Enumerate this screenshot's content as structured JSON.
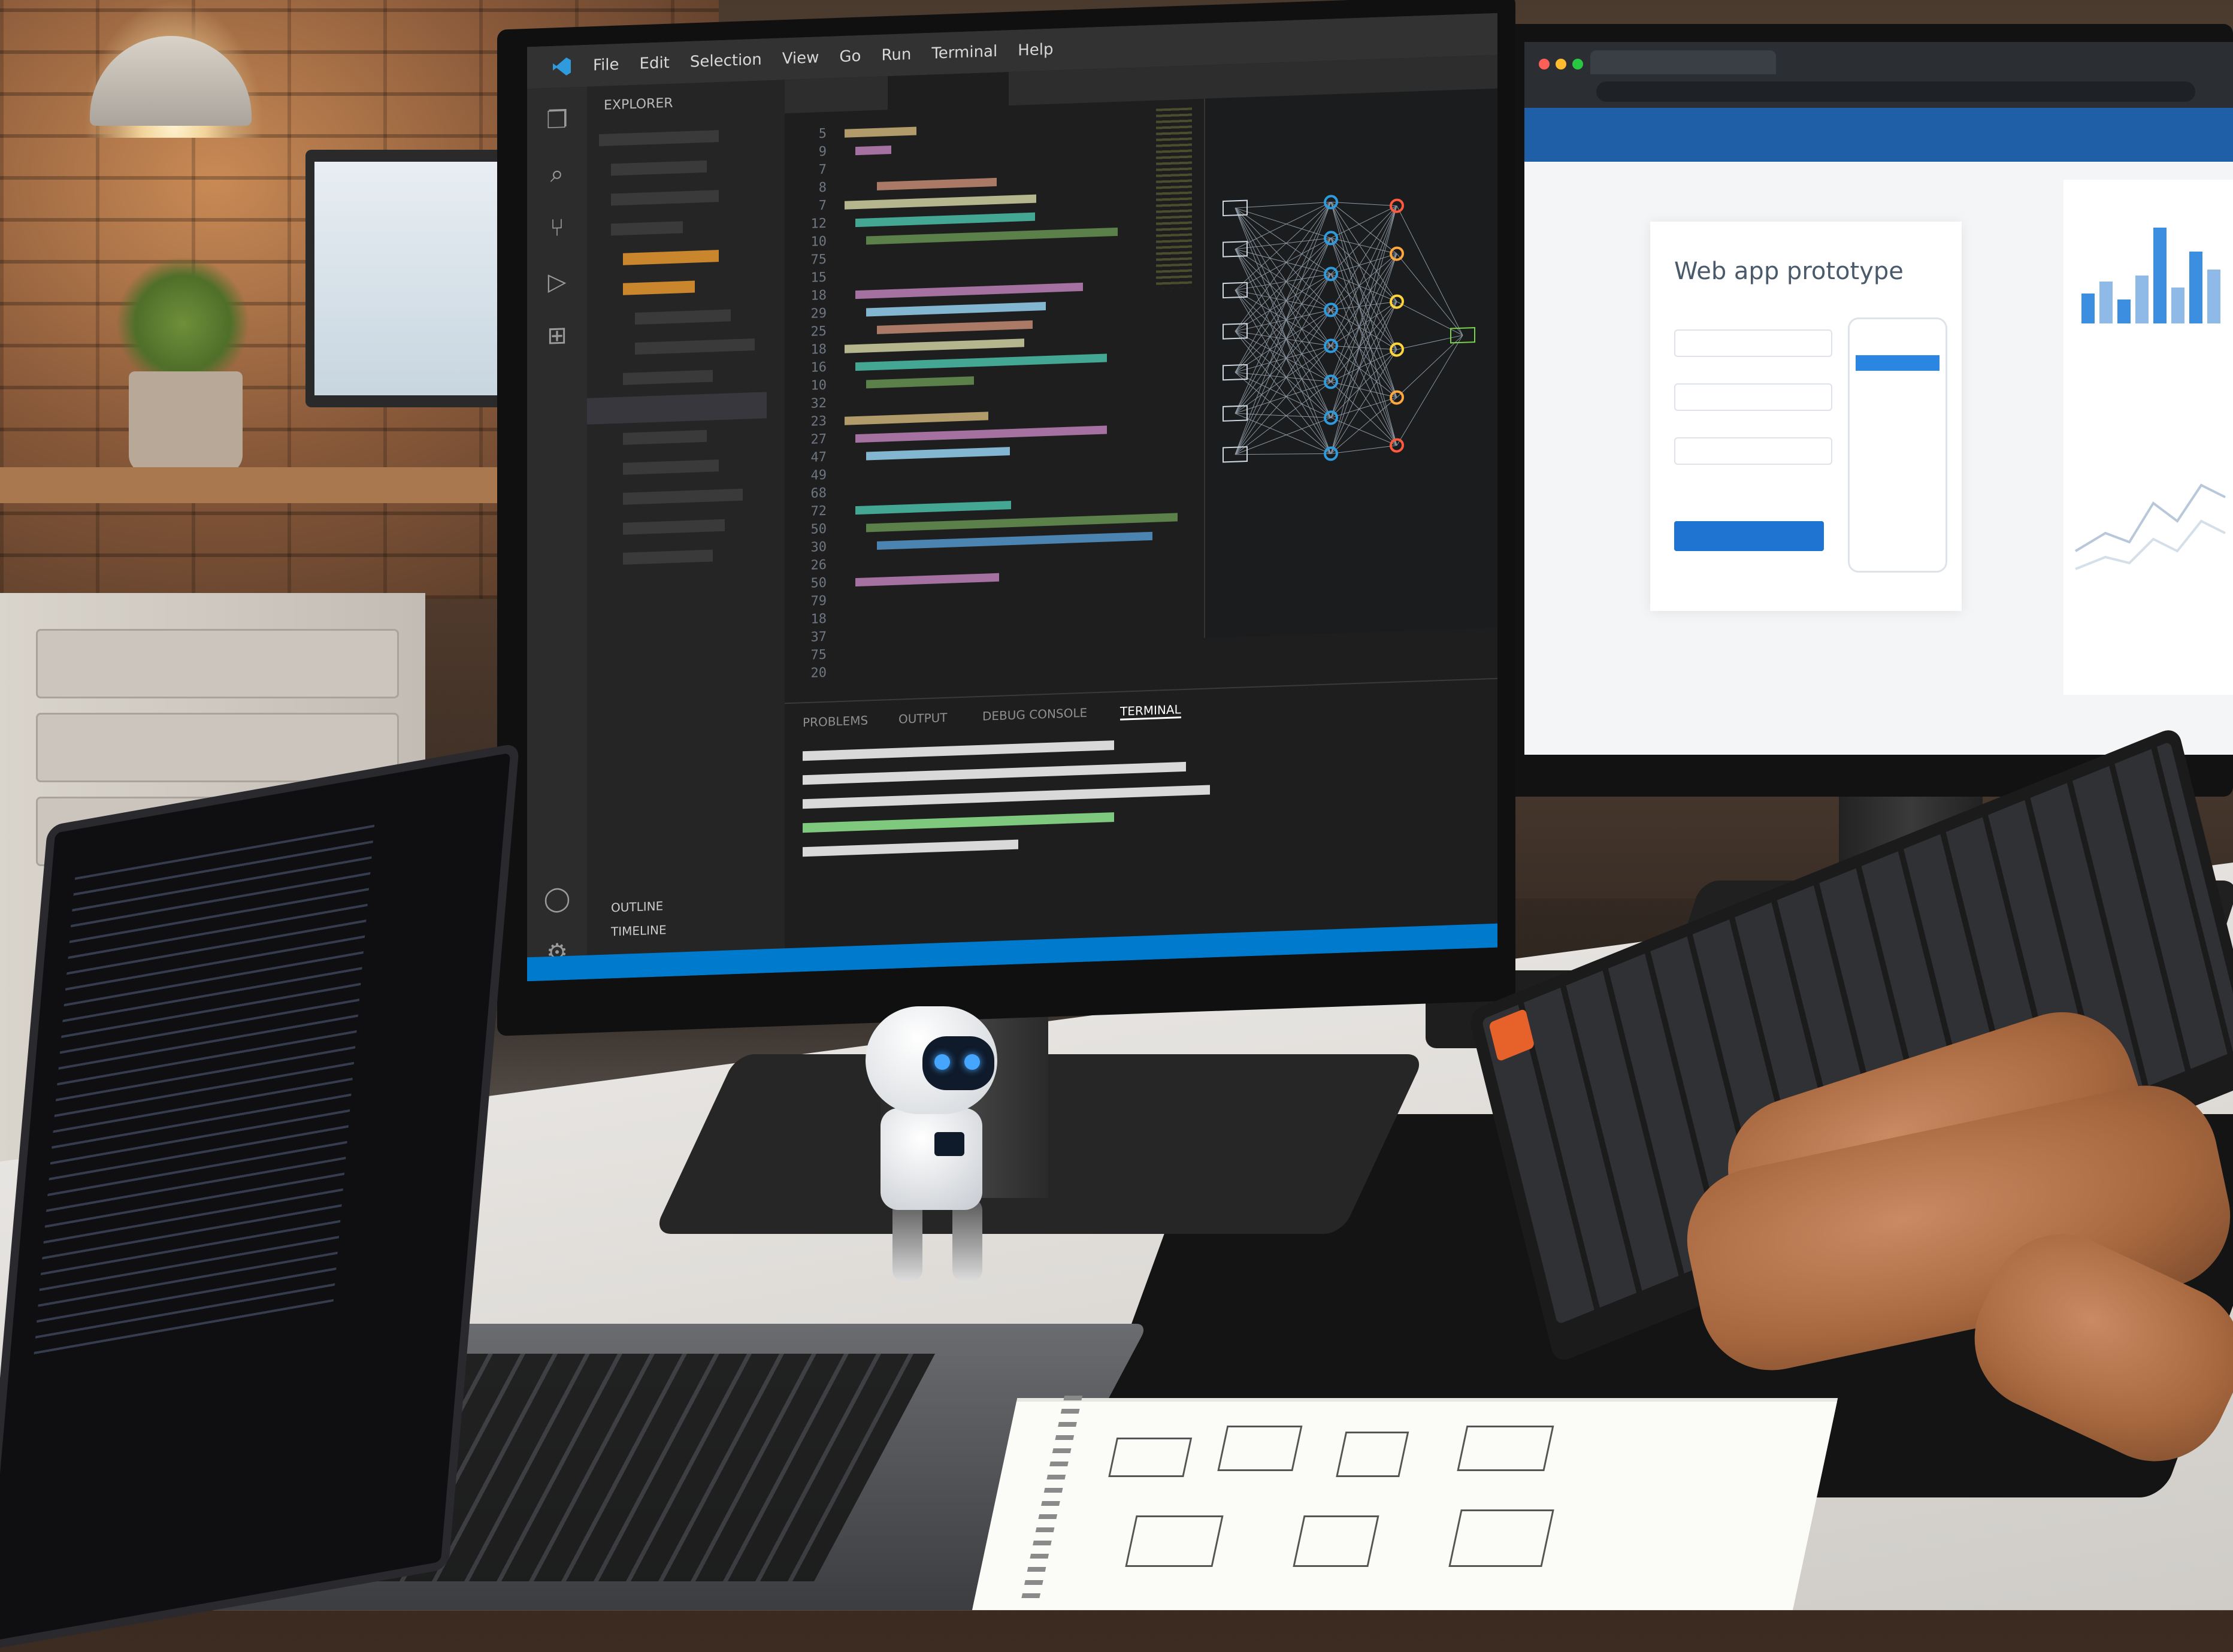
{
  "editor": {
    "menu": [
      "File",
      "Edit",
      "Selection",
      "View",
      "Go",
      "Run",
      "Terminal",
      "Help"
    ],
    "sidebar_header": "EXPLORER",
    "panel_tabs": [
      "PROBLEMS",
      "OUTPUT",
      "DEBUG CONSOLE",
      "TERMINAL"
    ],
    "outline_items": [
      "OUTLINE",
      "TIMELINE"
    ],
    "line_numbers": [
      "5",
      "9",
      "7",
      "8",
      "7",
      "12",
      "10",
      "75",
      "15",
      "18",
      "29",
      "25",
      "18",
      "16",
      "10",
      "32",
      "23",
      "27",
      "47",
      "49",
      "68",
      "72",
      "50",
      "30",
      "26",
      "50",
      "79",
      "18",
      "37",
      "75",
      "20"
    ]
  },
  "browser": {
    "card_title": "Web app prototype"
  },
  "colors": {
    "vscode_accent": "#007acc",
    "browser_header": "#1e5fa8",
    "primary_button": "#1f73d1",
    "escape_key": "#e7612b",
    "robot_eye": "#46a6ff"
  }
}
